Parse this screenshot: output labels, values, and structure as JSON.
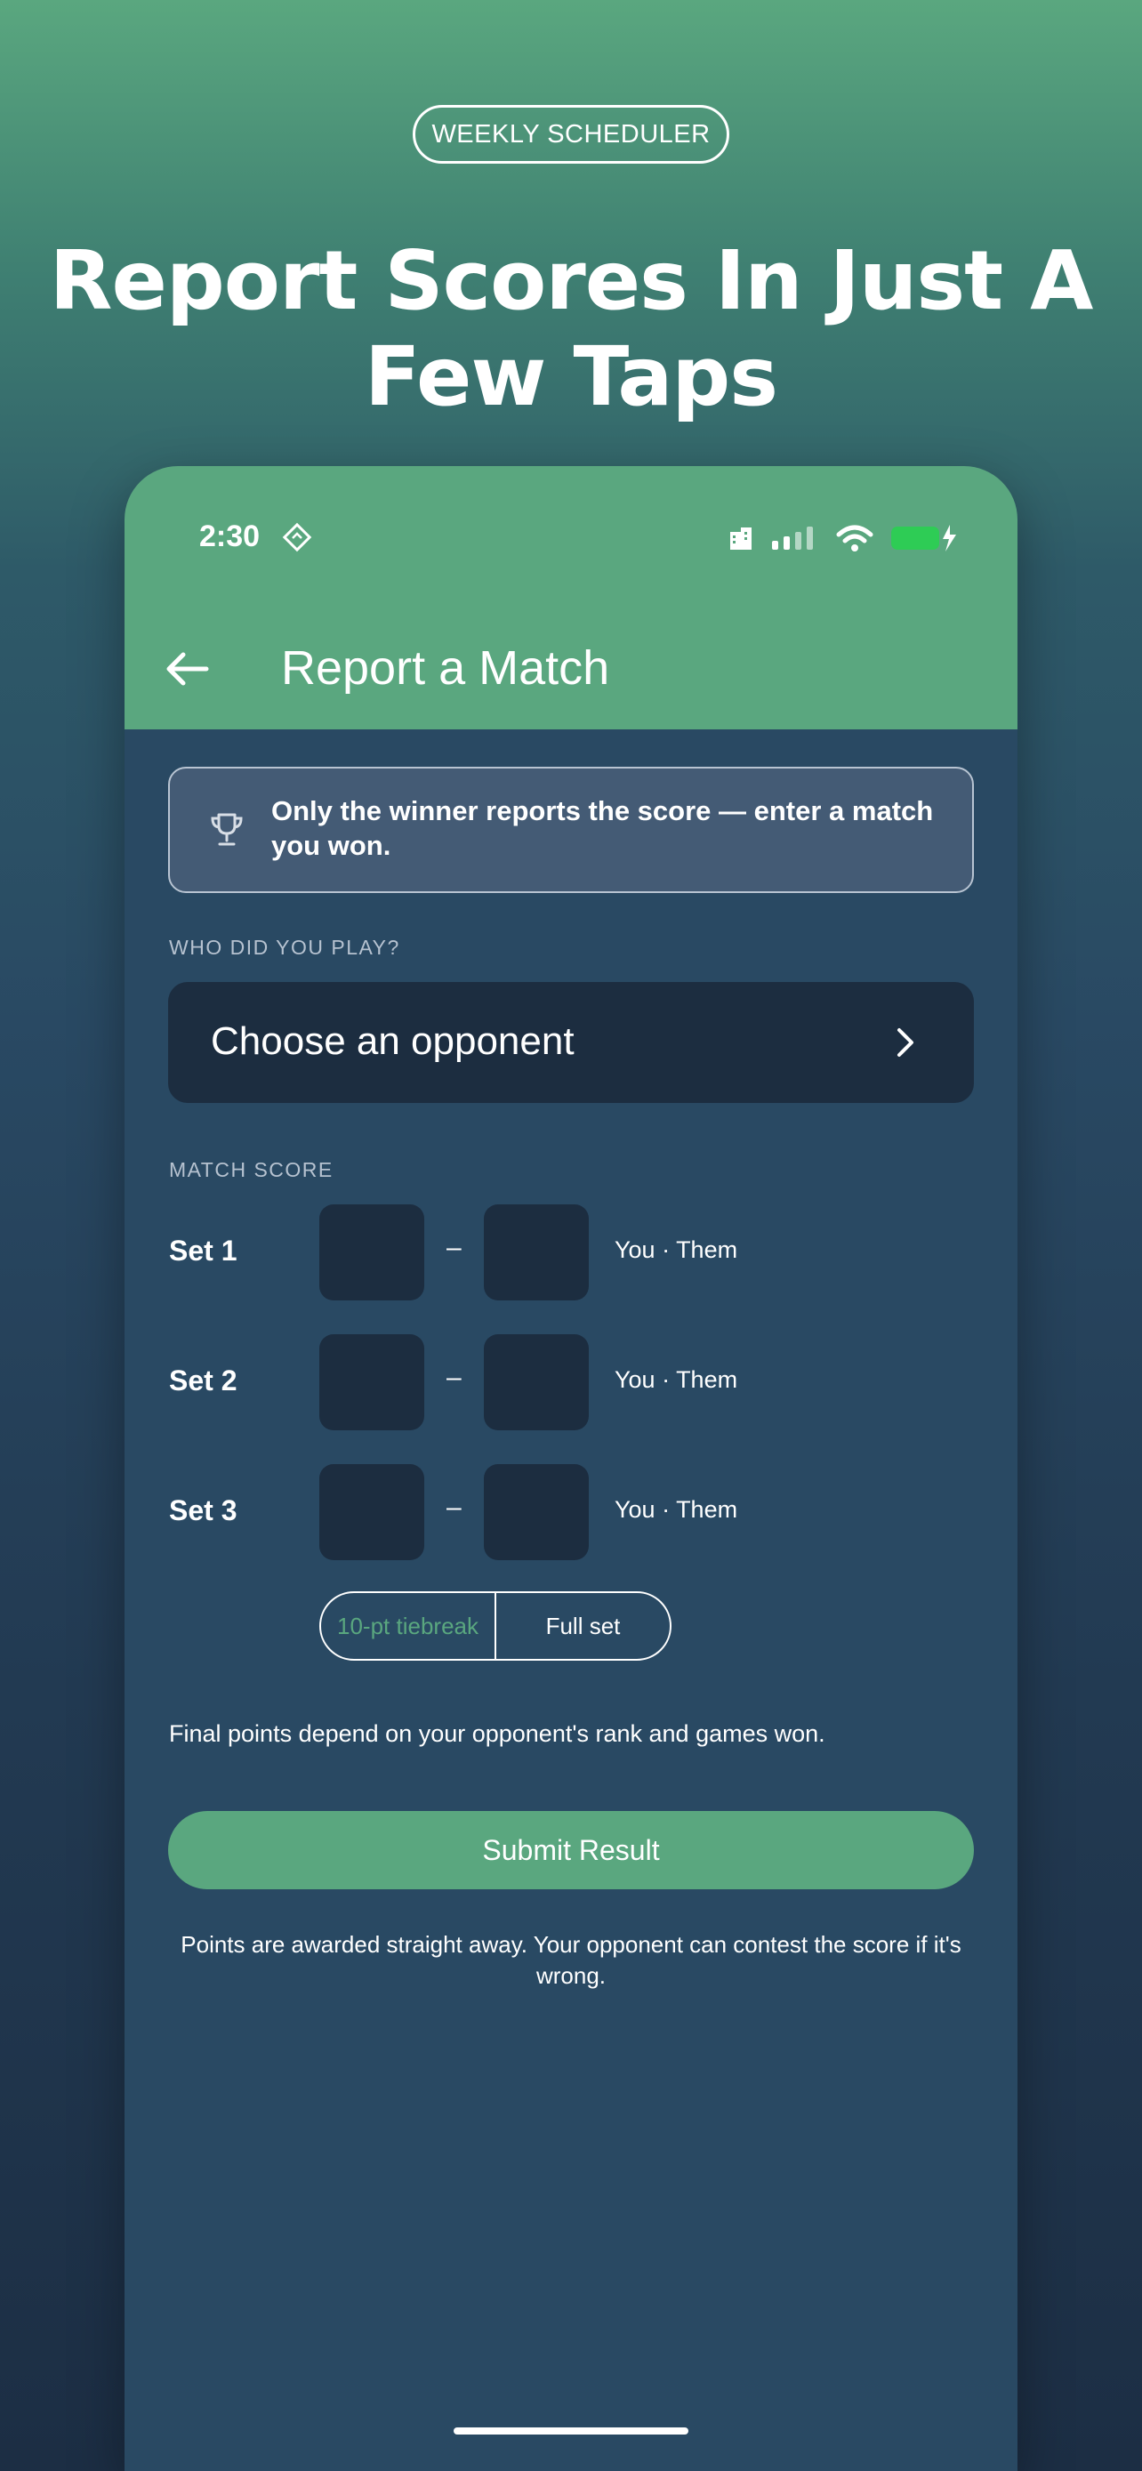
{
  "promo": {
    "badge": "WEEKLY SCHEDULER",
    "headline": "Report Scores In Just A Few Taps"
  },
  "status_bar": {
    "time": "2:30"
  },
  "appbar": {
    "title": "Report a Match"
  },
  "notice": {
    "text": "Only the winner reports the score — enter a match you won."
  },
  "opponent_section": {
    "label": "WHO DID YOU PLAY?",
    "placeholder": "Choose an opponent"
  },
  "score_section": {
    "label": "MATCH SCORE",
    "sets": [
      {
        "label": "Set 1",
        "dash": "–",
        "hint": "You · Them"
      },
      {
        "label": "Set 2",
        "dash": "–",
        "hint": "You · Them"
      },
      {
        "label": "Set 3",
        "dash": "–",
        "hint": "You · Them"
      }
    ],
    "third_set_format": {
      "options": [
        "10-pt tiebreak",
        "Full set"
      ],
      "selected": "Full set"
    }
  },
  "points_note": "Final points depend on your opponent's rank and games won.",
  "submit_label": "Submit Result",
  "footer_note": "Points are awarded straight away. Your opponent can contest the score if it's wrong.",
  "colors": {
    "brand_green": "#5aa77f",
    "screen_bg": "#294963",
    "input_bg": "#1c2d40",
    "notice_bg": "#445b75",
    "battery_green": "#2ecc55"
  }
}
